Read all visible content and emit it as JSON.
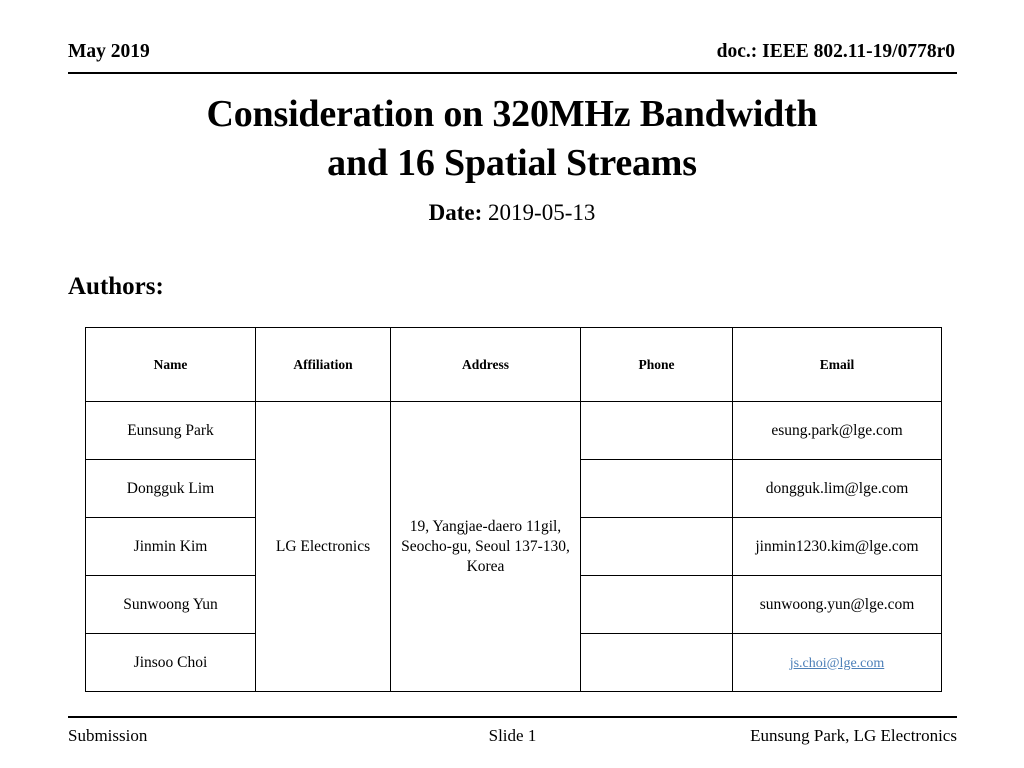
{
  "header": {
    "date": "May 2019",
    "doc_id": "doc.: IEEE 802.11-19/0778r0"
  },
  "title": {
    "text": "Consideration on 320MHz Bandwidth\nand 16 Spatial Streams",
    "date_label": "Date:",
    "date_value": "2019-05-13"
  },
  "authors": {
    "heading": "Authors:",
    "columns": [
      "Name",
      "Affiliation",
      "Address",
      "Phone",
      "Email"
    ],
    "affiliation": "LG Electronics",
    "address": "19, Yangjae-daero 11gil, Seocho-gu, Seoul 137-130, Korea",
    "rows": [
      {
        "name": "Eunsung Park",
        "phone": "",
        "email": "esung.park@lge.com",
        "email_is_link": false
      },
      {
        "name": "Dongguk Lim",
        "phone": "",
        "email": "dongguk.lim@lge.com",
        "email_is_link": false
      },
      {
        "name": "Jinmin Kim",
        "phone": "",
        "email": "jinmin1230.kim@lge.com",
        "email_is_link": false
      },
      {
        "name": "Sunwoong Yun",
        "phone": "",
        "email": "sunwoong.yun@lge.com",
        "email_is_link": false
      },
      {
        "name": "Jinsoo Choi",
        "phone": "",
        "email": "js.choi@lge.com",
        "email_is_link": true
      }
    ]
  },
  "footer": {
    "left": "Submission",
    "center": "Slide 1",
    "right": "Eunsung Park, LG Electronics"
  },
  "colors": {
    "link": "#4c7fb8",
    "rule": "#000000",
    "text": "#000000",
    "background": "#ffffff"
  }
}
